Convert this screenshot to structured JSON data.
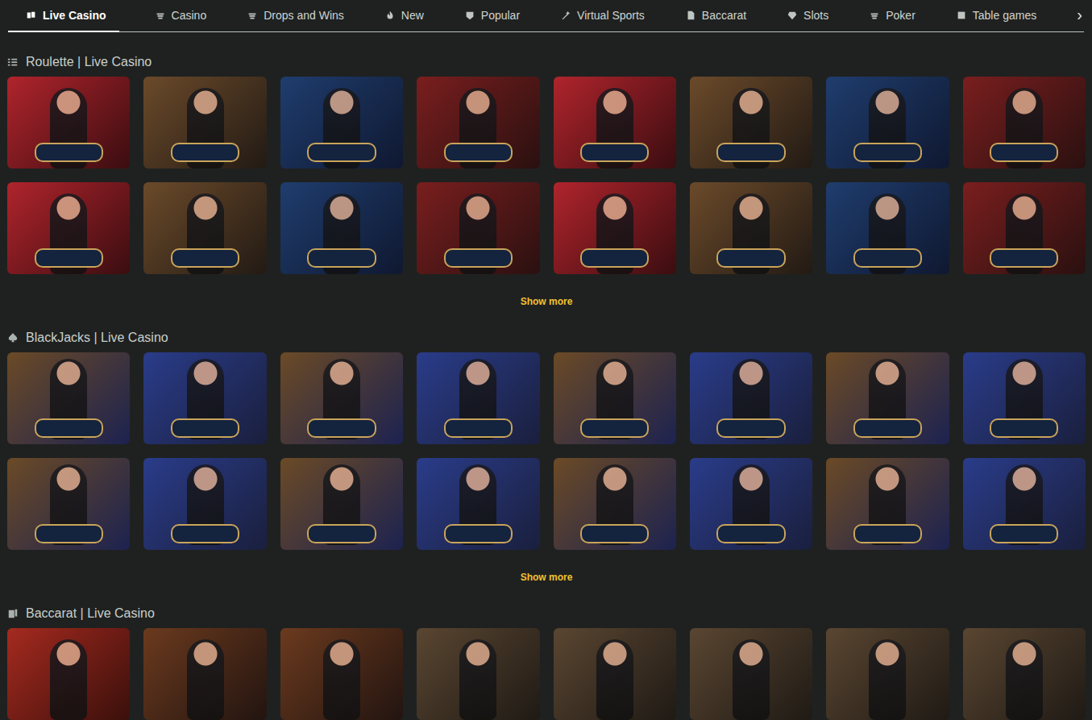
{
  "nav": {
    "tabs": [
      {
        "label": "Live Casino",
        "selected": true
      },
      {
        "label": "Casino",
        "selected": false
      },
      {
        "label": "Drops and Wins",
        "selected": false
      },
      {
        "label": "New",
        "selected": false
      },
      {
        "label": "Popular",
        "selected": false
      },
      {
        "label": "Virtual Sports",
        "selected": false
      },
      {
        "label": "Baccarat",
        "selected": false
      },
      {
        "label": "Slots",
        "selected": false
      },
      {
        "label": "Poker",
        "selected": false
      },
      {
        "label": "Table games",
        "selected": false
      }
    ],
    "more": "›"
  },
  "sections": [
    {
      "title": "Roulette | Live Casino",
      "kind": "roulette",
      "tile_count": 16,
      "show_more": "Show more"
    },
    {
      "title": "BlackJacks | Live Casino",
      "kind": "blackjack",
      "tile_count": 16,
      "show_more": "Show more"
    },
    {
      "title": "Baccarat | Live Casino",
      "kind": "baccarat",
      "tile_count": 8
    }
  ]
}
